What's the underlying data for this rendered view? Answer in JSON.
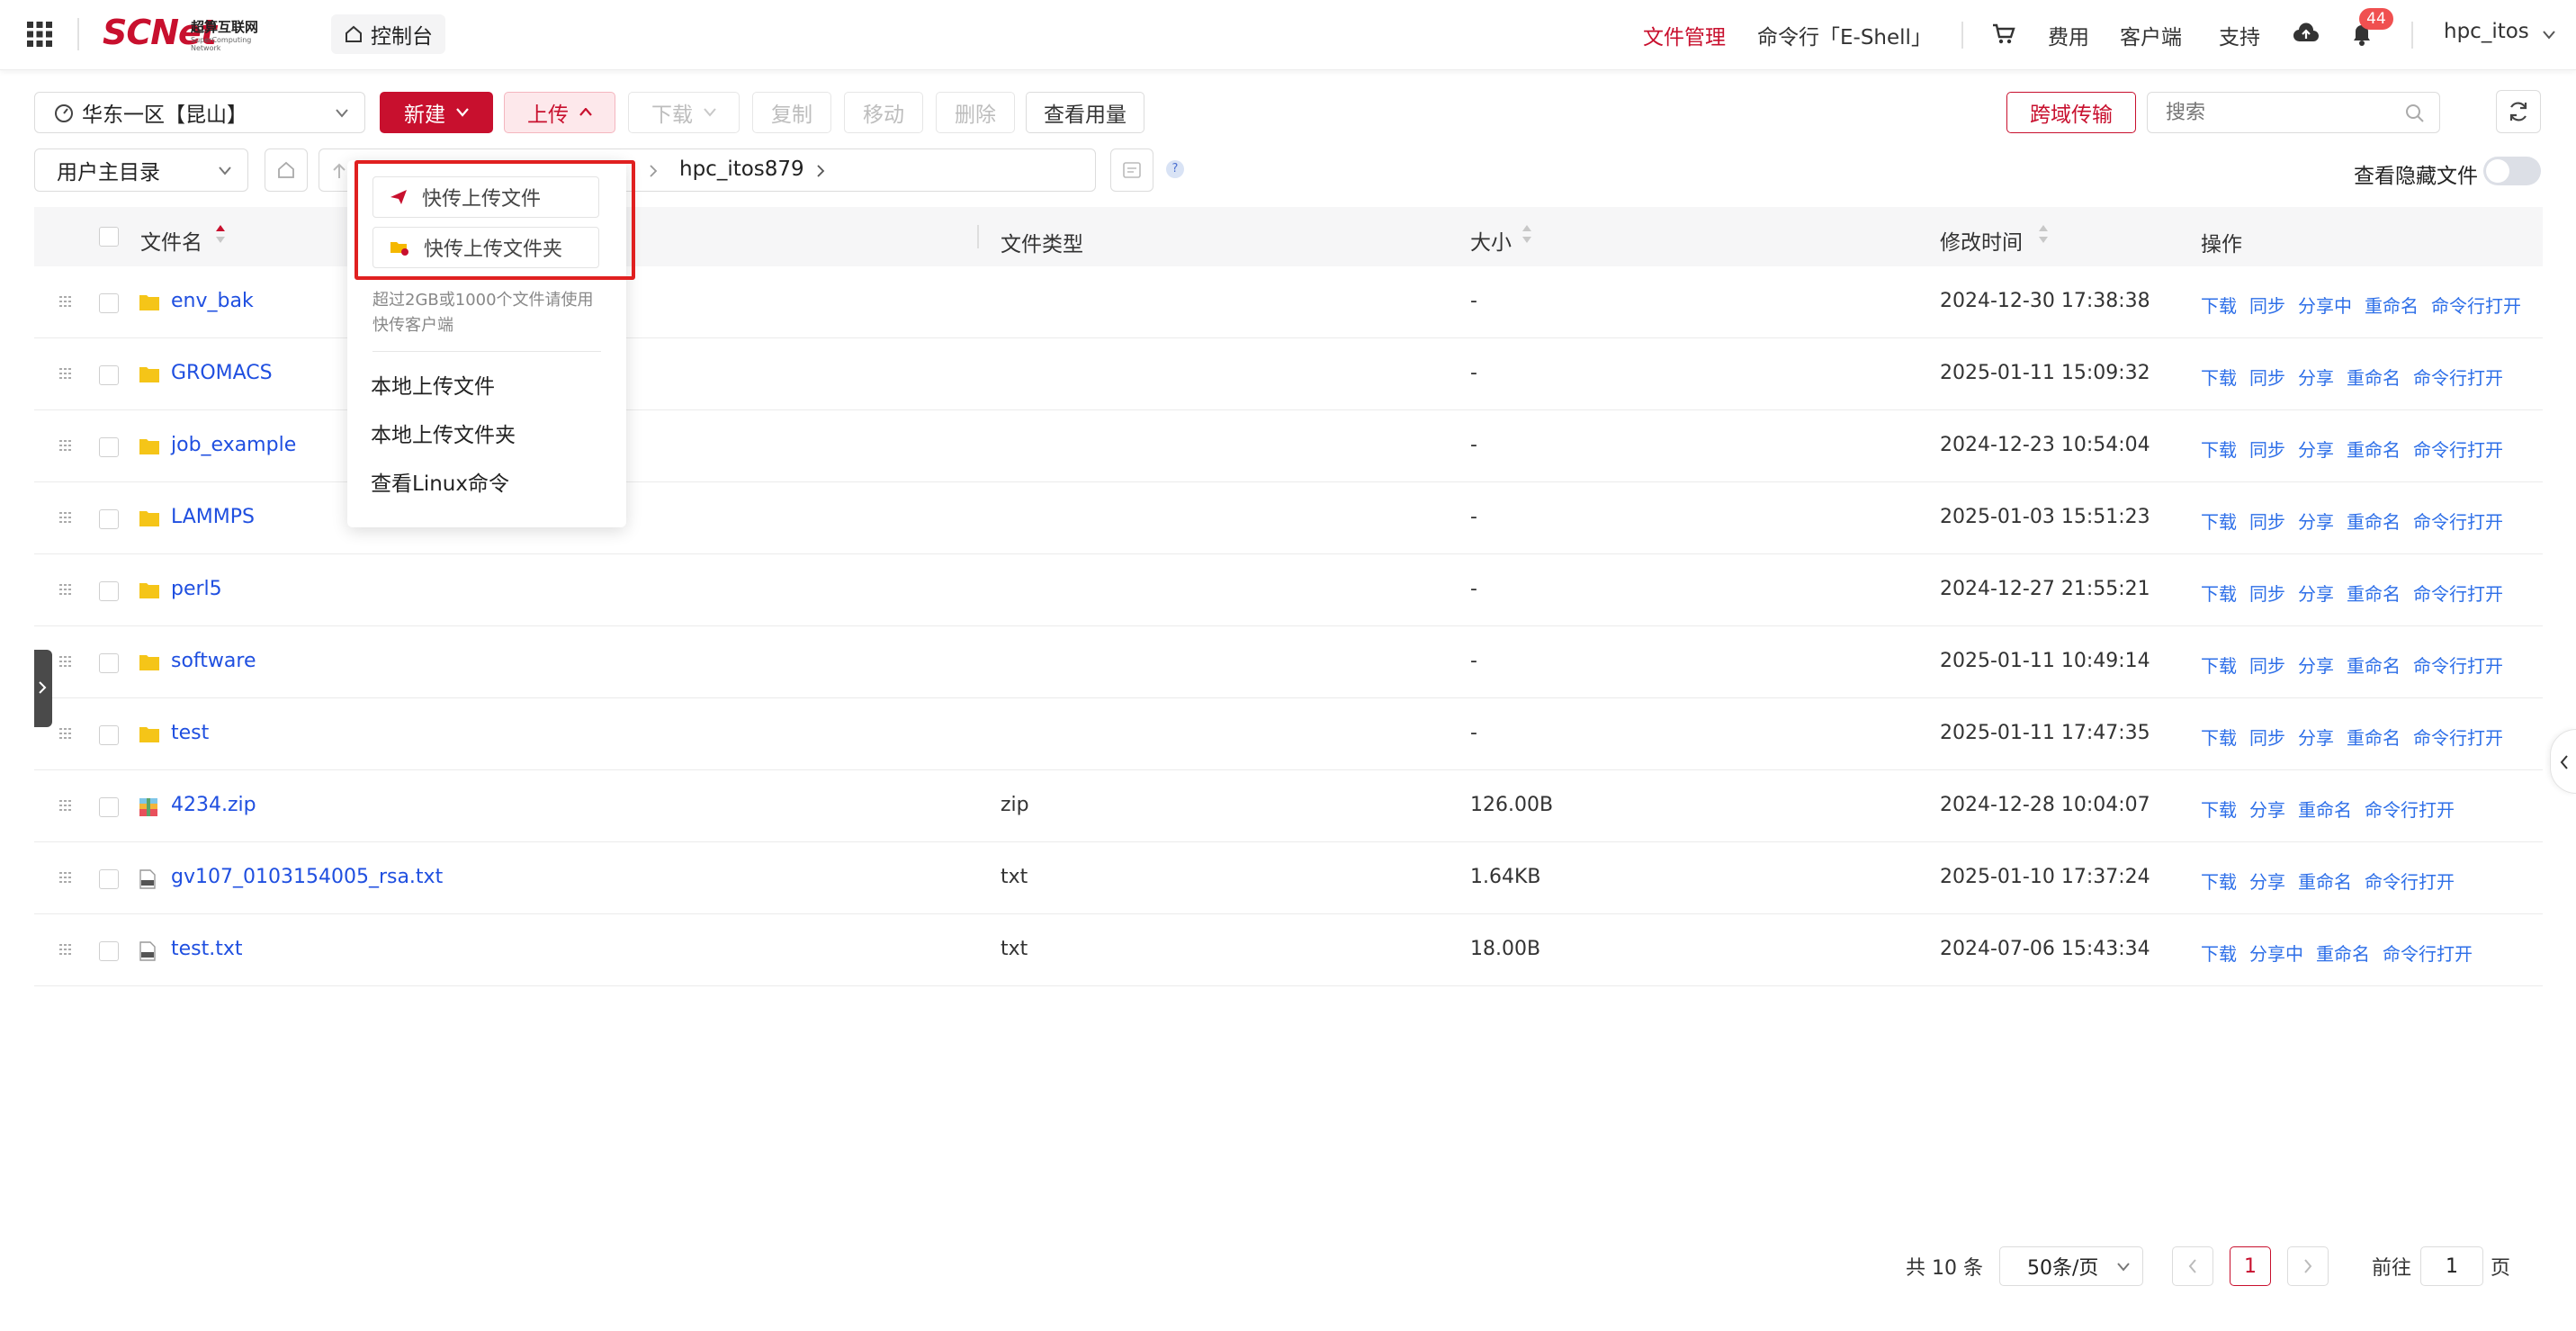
{
  "header": {
    "logo_text": "SCNet",
    "logo_cn": "超算互联网",
    "logo_en": "SuperComputing Network",
    "console": "控制台",
    "nav": [
      "文件管理",
      "命令行「E-Shell」"
    ],
    "links": [
      "费用",
      "客户端",
      "支持"
    ],
    "notifications": "44",
    "username": "hpc_itos"
  },
  "toolbar": {
    "region": "华东一区【昆山】",
    "new_label": "新建",
    "upload_label": "上传",
    "download_label": "下载",
    "copy_label": "复制",
    "move_label": "移动",
    "delete_label": "删除",
    "usage_label": "查看用量",
    "cross_domain_label": "跨域传输",
    "search_placeholder": "搜索"
  },
  "pathbar": {
    "root_select": "用户主目录",
    "crumb": "hpc_itos879",
    "help": "?",
    "hidden_files_label": "查看隐藏文件"
  },
  "upload_menu": {
    "fast_upload_file": "快传上传文件",
    "fast_upload_folder": "快传上传文件夹",
    "note": "超过2GB或1000个文件请使用",
    "note2": "快传客户端",
    "local_upload_file": "本地上传文件",
    "local_upload_folder": "本地上传文件夹",
    "linux_cmd": "查看Linux命令"
  },
  "table": {
    "columns": {
      "name": "文件名",
      "type": "文件类型",
      "size": "大小",
      "mtime": "修改时间",
      "ops": "操作"
    },
    "rows": [
      {
        "name": "env_bak",
        "kind": "folder",
        "type": "",
        "size": "-",
        "mtime": "2024-12-30 17:38:38",
        "ops": [
          "下载",
          "同步",
          "分享中",
          "重命名",
          "命令行打开"
        ]
      },
      {
        "name": "GROMACS",
        "kind": "folder",
        "type": "",
        "size": "-",
        "mtime": "2025-01-11 15:09:32",
        "ops": [
          "下载",
          "同步",
          "分享",
          "重命名",
          "命令行打开"
        ]
      },
      {
        "name": "job_example",
        "kind": "folder",
        "type": "",
        "size": "-",
        "mtime": "2024-12-23 10:54:04",
        "ops": [
          "下载",
          "同步",
          "分享",
          "重命名",
          "命令行打开"
        ]
      },
      {
        "name": "LAMMPS",
        "kind": "folder",
        "type": "",
        "size": "-",
        "mtime": "2025-01-03 15:51:23",
        "ops": [
          "下载",
          "同步",
          "分享",
          "重命名",
          "命令行打开"
        ]
      },
      {
        "name": "perl5",
        "kind": "folder",
        "type": "",
        "size": "-",
        "mtime": "2024-12-27 21:55:21",
        "ops": [
          "下载",
          "同步",
          "分享",
          "重命名",
          "命令行打开"
        ]
      },
      {
        "name": "software",
        "kind": "folder",
        "type": "",
        "size": "-",
        "mtime": "2025-01-11 10:49:14",
        "ops": [
          "下载",
          "同步",
          "分享",
          "重命名",
          "命令行打开"
        ]
      },
      {
        "name": "test",
        "kind": "folder",
        "type": "",
        "size": "-",
        "mtime": "2025-01-11 17:47:35",
        "ops": [
          "下载",
          "同步",
          "分享",
          "重命名",
          "命令行打开"
        ]
      },
      {
        "name": "4234.zip",
        "kind": "zip",
        "type": "zip",
        "size": "126.00B",
        "mtime": "2024-12-28 10:04:07",
        "ops": [
          "下载",
          "分享",
          "重命名",
          "命令行打开"
        ]
      },
      {
        "name": "gv107_0103154005_rsa.txt",
        "kind": "txt",
        "type": "txt",
        "size": "1.64KB",
        "mtime": "2025-01-10 17:37:24",
        "ops": [
          "下载",
          "分享",
          "重命名",
          "命令行打开"
        ]
      },
      {
        "name": "test.txt",
        "kind": "txt",
        "type": "txt",
        "size": "18.00B",
        "mtime": "2024-07-06 15:43:34",
        "ops": [
          "下载",
          "分享中",
          "重命名",
          "命令行打开"
        ]
      }
    ]
  },
  "pagination": {
    "total": "共 10 条",
    "page_size": "50条/页",
    "current": "1",
    "goto_label": "前往",
    "goto_value": "1",
    "page_suffix": "页"
  },
  "colors": {
    "brand": "#c8102e",
    "link": "#1f4fe0",
    "op_link": "#2e6fe8",
    "folder": "#f5c518"
  }
}
